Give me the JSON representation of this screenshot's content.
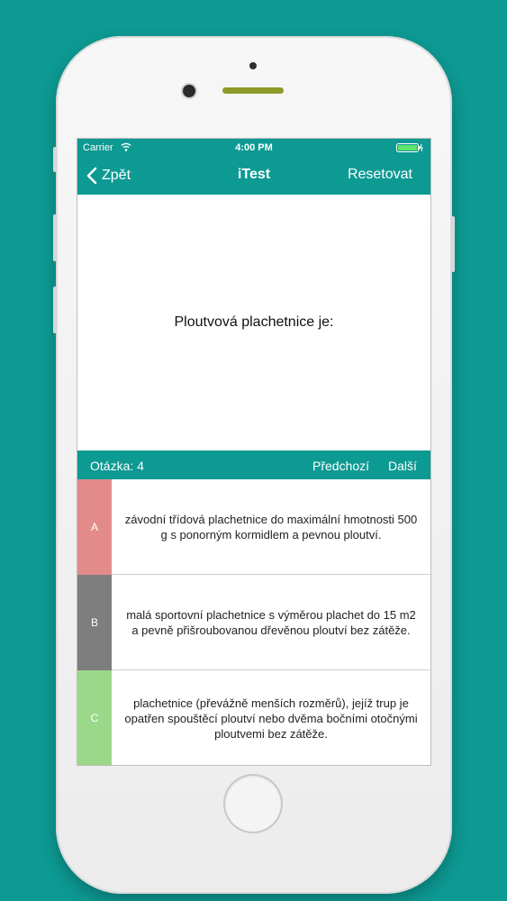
{
  "colors": {
    "accent": "#0d9a93",
    "answer_a": "#e38b8b",
    "answer_b": "#7e7e7e",
    "answer_c": "#9bd98a"
  },
  "status": {
    "carrier": "Carrier",
    "time": "4:00 PM"
  },
  "nav": {
    "back_label": "Zpět",
    "title": "iTest",
    "reset_label": "Resetovat"
  },
  "question": {
    "text": "Ploutvová plachetnice je:"
  },
  "question_bar": {
    "label": "Otázka: 4",
    "prev": "Předchozí",
    "next": "Další"
  },
  "answers": [
    {
      "letter": "A",
      "text": "závodní třídová plachetnice do maximální hmotnosti 500 g s ponorným kormidlem a pevnou ploutví."
    },
    {
      "letter": "B",
      "text": "malá sportovní plachetnice s výměrou plachet do 15 m2 a pevně přišroubovanou dřevěnou ploutví bez zátěže."
    },
    {
      "letter": "C",
      "text": "plachetnice (převážně menších rozměrů), jejíž trup je opatřen spouštěcí ploutví nebo dvěma bočními otočnými ploutvemi bez zátěže."
    }
  ]
}
